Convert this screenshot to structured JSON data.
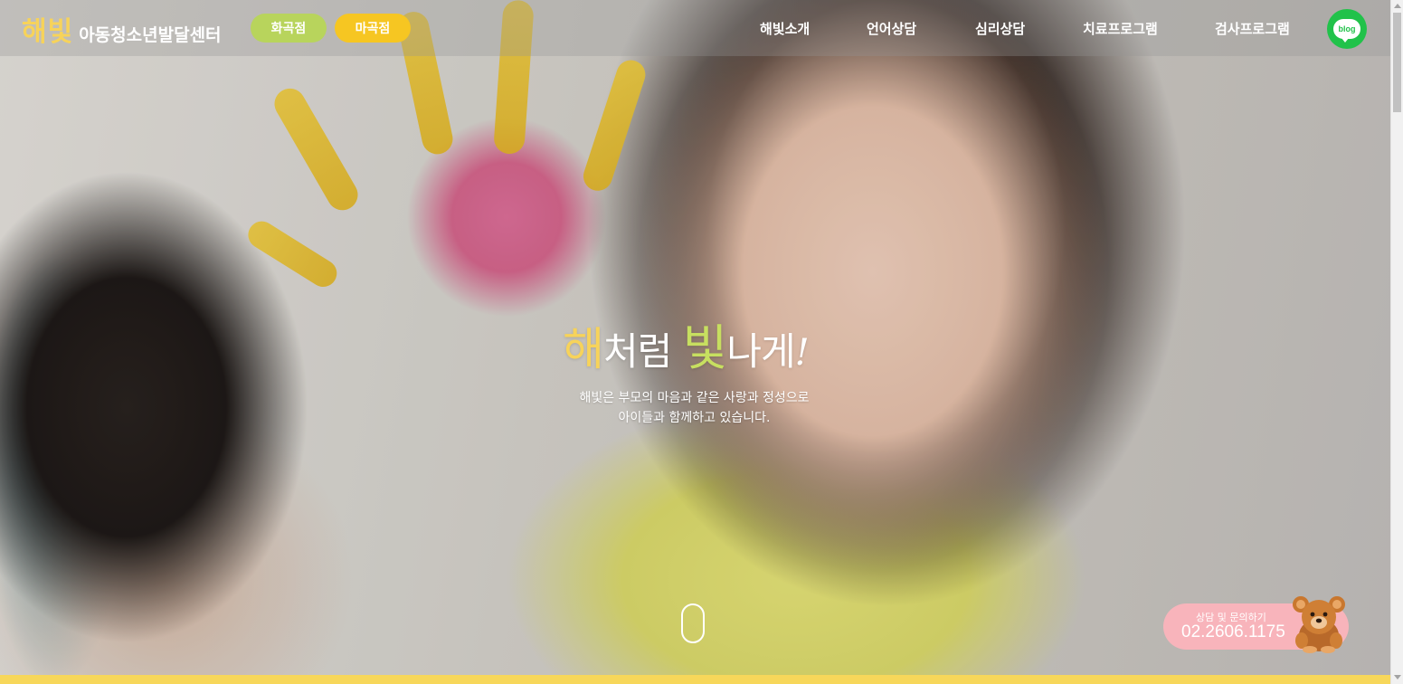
{
  "header": {
    "brand": "해빛",
    "brand_sub": "아동청소년발달센터",
    "branches": [
      "화곡점",
      "마곡점"
    ],
    "nav": [
      "해빛소개",
      "언어상담",
      "심리상담",
      "치료프로그램",
      "검사프로그램"
    ],
    "blog_label": "blog"
  },
  "hero": {
    "headline_1": "해",
    "headline_2": "처럼 ",
    "headline_3": "빛",
    "headline_4": "나게",
    "headline_5": "!",
    "tagline_line1": "해빛은 부모의 마음과 같은 사랑과 정성으로",
    "tagline_line2": "아이들과 함께하고 있습니다."
  },
  "contact": {
    "label": "상담 및 문의하기",
    "phone": "02.2606.1175"
  },
  "colors": {
    "brand_yellow": "#f7d35a",
    "brand_green": "#c7df60",
    "branch_green": "#b8d45c",
    "branch_yellow": "#f6c622",
    "contact_pink": "#f8b4bb",
    "blog_green": "#21c24a"
  },
  "icons": {
    "blog": "blog-bubble-icon",
    "scroll": "scroll-mouse-icon",
    "mascot": "teddy-bear-icon"
  }
}
